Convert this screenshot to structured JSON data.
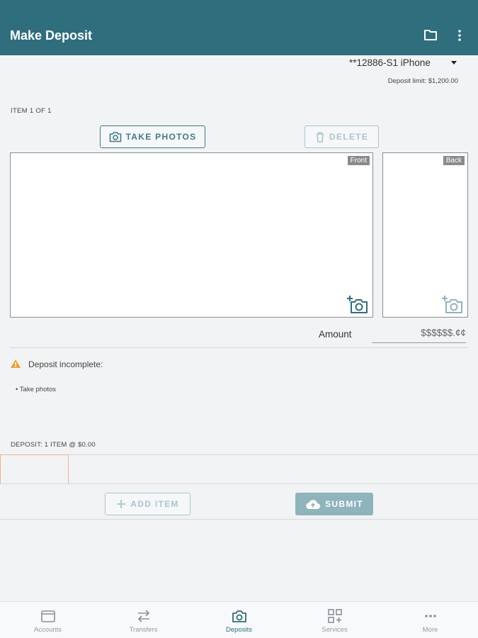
{
  "header": {
    "title": "Make Deposit",
    "folder_icon": "folder-icon",
    "menu_icon": "more-vert-icon"
  },
  "account": {
    "selected": "**12886-S1 iPhone",
    "limit": "Deposit limit: $1,200.00"
  },
  "item": {
    "label": "ITEM 1 OF 1"
  },
  "actions": {
    "take_photos": "TAKE PHOTOS",
    "delete": "DELETE"
  },
  "photos": {
    "front_label": "Front",
    "back_label": "Back"
  },
  "amount": {
    "label": "Amount",
    "placeholder": "$$$$$$.¢¢"
  },
  "status": {
    "message": "Deposit incomplete:",
    "todo": "• Take photos"
  },
  "deposit": {
    "summary": "DEPOSIT: 1 ITEM @ $0.00"
  },
  "footer_actions": {
    "add_item": "ADD ITEM",
    "submit": "SUBMIT"
  },
  "nav": {
    "items": [
      {
        "label": "Accounts",
        "icon": "wallet-icon"
      },
      {
        "label": "Transfers",
        "icon": "transfer-arrows-icon"
      },
      {
        "label": "Deposits",
        "icon": "camera-icon"
      },
      {
        "label": "Services",
        "icon": "grid-plus-icon"
      },
      {
        "label": "More",
        "icon": "more-horiz-icon"
      }
    ],
    "active": "Deposits"
  },
  "colors": {
    "primary": "#2f6e7c",
    "warning": "#f0a02e",
    "disabled": "#a9c7cd",
    "highlight": "#f4b28a"
  }
}
